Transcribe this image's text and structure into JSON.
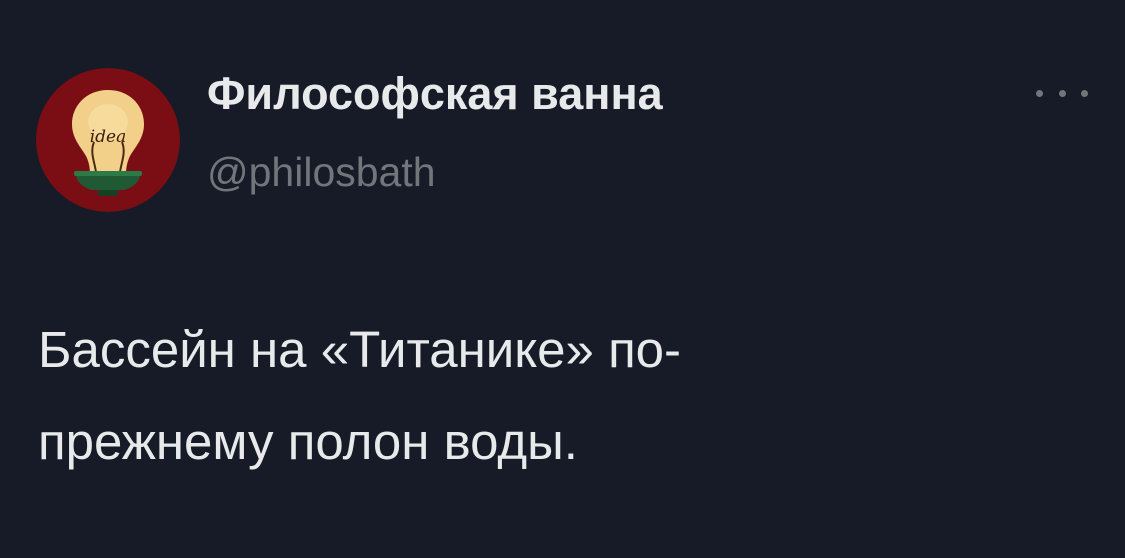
{
  "author": {
    "display_name": "Философская ванна",
    "handle": "@philosbath",
    "avatar_icon": "lightbulb-idea-icon",
    "avatar_text": "idea",
    "avatar_colors": {
      "background": "#7b0e14",
      "bulb": "#f2d08a",
      "base": "#1f5a34"
    }
  },
  "menu": {
    "icon": "more-dots-icon"
  },
  "tweet": {
    "lines": [
      "Бассейн на «Титанике» по-",
      "прежнему полон воды."
    ]
  },
  "colors": {
    "background": "#161b27",
    "text_primary": "#e7e9ea",
    "text_secondary": "#71767b"
  }
}
